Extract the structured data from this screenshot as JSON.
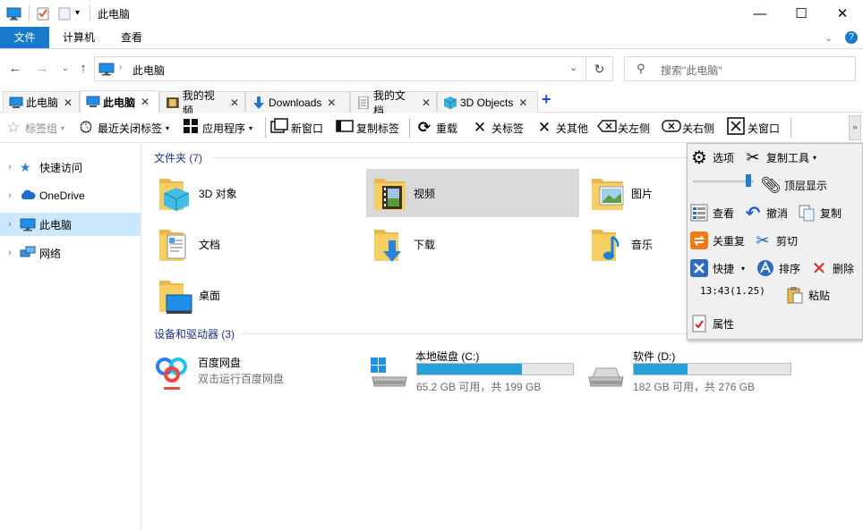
{
  "titlebar": {
    "title": "此电脑",
    "minimize": "—",
    "maximize": "☐",
    "close": "✕"
  },
  "ribbon": {
    "tabs": [
      "文件",
      "计算机",
      "查看"
    ],
    "help": "?"
  },
  "address": {
    "path": "此电脑",
    "search_placeholder": "搜索\"此电脑\""
  },
  "tabs": [
    {
      "label": "此电脑",
      "icon": "computer-icon"
    },
    {
      "label": "此电脑",
      "icon": "computer-icon"
    },
    {
      "label": "我的视频",
      "icon": "video-icon"
    },
    {
      "label": "Downloads",
      "icon": "download-icon"
    },
    {
      "label": "我的文档",
      "icon": "document-icon"
    },
    {
      "label": "3D Objects",
      "icon": "cube-icon"
    }
  ],
  "tab_add": "+",
  "toolbar": {
    "tag_group": "标签组",
    "recent_closed": "最近关闭标签",
    "apps": "应用程序",
    "new_window": "新窗口",
    "copy_tab": "复制标签",
    "reload": "重载",
    "close_tab": "关标签",
    "close_others": "关其他",
    "close_left": "关左侧",
    "close_right": "关右侧",
    "close_window": "关窗口"
  },
  "sidebar": {
    "items": [
      {
        "label": "快速访问",
        "icon": "star-icon"
      },
      {
        "label": "OneDrive",
        "icon": "cloud-icon"
      },
      {
        "label": "此电脑",
        "icon": "computer-icon"
      },
      {
        "label": "网络",
        "icon": "network-icon"
      }
    ]
  },
  "folders_group": "文件夹 (7)",
  "folders": [
    {
      "name": "3D 对象",
      "icon": "3d-folder-icon"
    },
    {
      "name": "视频",
      "icon": "video-folder-icon"
    },
    {
      "name": "图片",
      "icon": "pictures-folder-icon"
    },
    {
      "name": "文档",
      "icon": "documents-folder-icon"
    },
    {
      "name": "下载",
      "icon": "downloads-folder-icon"
    },
    {
      "name": "音乐",
      "icon": "music-folder-icon"
    },
    {
      "name": "桌面",
      "icon": "desktop-folder-icon"
    }
  ],
  "devices_group": "设备和驱动器 (3)",
  "devices": [
    {
      "name": "百度网盘",
      "sub": "双击运行百度网盘"
    },
    {
      "name": "本地磁盘 (C:)",
      "sub": "65.2 GB 可用，共 199 GB",
      "used_fraction": 0.672
    },
    {
      "name": "软件 (D:)",
      "sub": "182 GB 可用，共 276 GB",
      "used_fraction": 0.341
    }
  ],
  "panel": {
    "options": "选项",
    "copy_tool": "复制工具",
    "topmost": "顶层显示",
    "view": "查看",
    "undo": "撤消",
    "copy": "复制",
    "close_dup": "关重复",
    "cut": "剪切",
    "shortcut": "快捷",
    "sort": "排序",
    "delete": "删除",
    "clock": "13:43(1.25)",
    "paste": "粘贴",
    "properties": "属性"
  },
  "colors": {
    "accent": "#1979ca",
    "selected_nav": "#cce8ff",
    "drive_bar": "#26a0da",
    "group_header": "#1e3287"
  }
}
